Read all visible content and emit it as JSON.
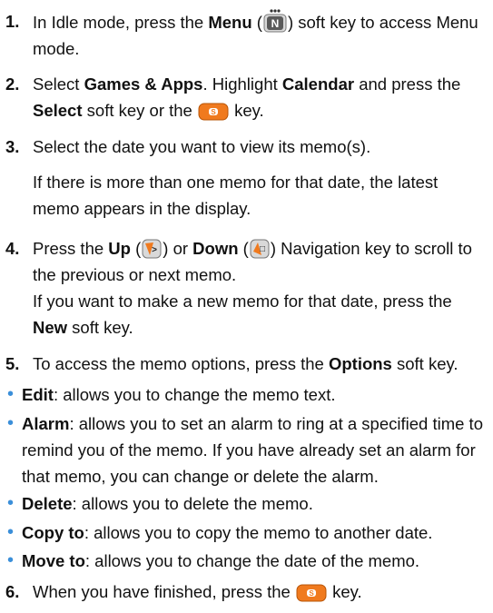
{
  "steps": [
    {
      "num": "1.",
      "t1": "In Idle mode, press the ",
      "menu": "Menu",
      "t2": " (",
      "t3": ") soft key to access Menu mode."
    },
    {
      "num": "2.",
      "t1": "Select ",
      "games_apps": "Games & Apps",
      "t2": ". Highlight ",
      "calendar": "Calendar",
      "t3": " and press the ",
      "select": "Select",
      "t4": " soft key or the ",
      "t5": " key."
    },
    {
      "num": "3.",
      "t1": "Select the date you want to view its memo(s).",
      "t2": "If there is more than one memo for that date, the latest memo appears in the display."
    },
    {
      "num": "4.",
      "t1": "Press the ",
      "up": "Up",
      "t2": " (",
      "t3": ") or ",
      "down": "Down",
      "t4": " (",
      "t5": ") Navigation key to scroll to the previous or next memo.",
      "t6": "If you want to make a new memo for that date, press the ",
      "new": "New",
      "t7": " soft key."
    },
    {
      "num": "5.",
      "t1": "To access the memo options, press the ",
      "options": "Options",
      "t2": " soft key."
    },
    {
      "num": "6.",
      "t1": "When you have finished, press the ",
      "t2": " key."
    }
  ],
  "bullets": [
    {
      "term": "Edit",
      "desc": ": allows you to change the memo text."
    },
    {
      "term": "Alarm",
      "desc": ": allows you to set an alarm to ring at a specified time to remind you of the memo. If you have already set an alarm for that memo, you can change or delete the alarm."
    },
    {
      "term": "Delete",
      "desc": ": allows you to delete the memo."
    },
    {
      "term": "Copy to",
      "desc": ": allows you to copy the memo to another date."
    },
    {
      "term": "Move to",
      "desc": ": allows you to change the date of the memo."
    }
  ],
  "icons": {
    "menu_key": "menu-key-icon",
    "send_key": "orange-send-key-icon",
    "up_key": "up-navigation-key-icon",
    "down_key": "down-navigation-key-icon"
  },
  "colors": {
    "bullet": "#3b8fd9",
    "send_key": "#f07a1e"
  }
}
